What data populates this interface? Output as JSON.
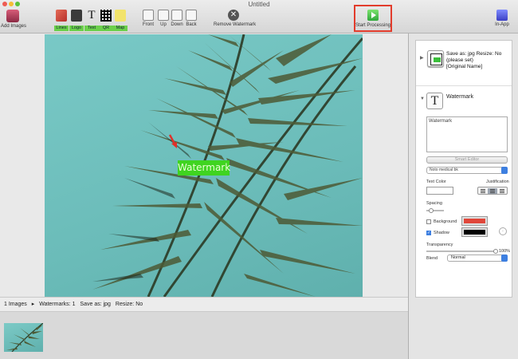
{
  "window": {
    "title": "Untitled"
  },
  "toolbar": {
    "add_images": "Add Images",
    "insert": {
      "lines": "Lines",
      "logo": "Logo",
      "text": "Text",
      "qr": "QR",
      "map": "Map",
      "text_glyph": "T"
    },
    "arrange": {
      "front": "Front",
      "up": "Up",
      "down": "Down",
      "back": "Back"
    },
    "remove_watermark": "Remove Watermark",
    "remove_glyph": "✕",
    "start_processing": "Start Processing",
    "in_app": "In-App"
  },
  "canvas": {
    "watermark_text": "Watermark"
  },
  "status": {
    "images": "1 Images",
    "watermarks": "Watermarks: 1",
    "save_as": "Save as: jpg",
    "resize": "Resize: No"
  },
  "panel": {
    "output": {
      "line1": "Save as: jpg  Resize: No",
      "line2": "(please set)",
      "line3": "[Original Name]"
    },
    "watermark": {
      "title": "Watermark",
      "text_glyph": "T",
      "text_value": "Watermark",
      "smart_editor": "Smart Editor",
      "font_name": "Noto medical bk",
      "text_color_label": "Text Color",
      "justification_label": "Justification",
      "spacing_label": "Spacing",
      "background_label": "Background",
      "shadow_label": "Shadow",
      "transparency_label": "Transparency",
      "transparency_value": "100%",
      "blend_label": "Blend",
      "blend_value": "Normal",
      "background_checked": false,
      "shadow_checked": true,
      "background_color": "#e0463a",
      "shadow_color": "#000000"
    }
  },
  "colors": {
    "accent_green": "#3fd420",
    "highlight_red": "#e23c2c",
    "select_blue": "#3d7fe0"
  }
}
